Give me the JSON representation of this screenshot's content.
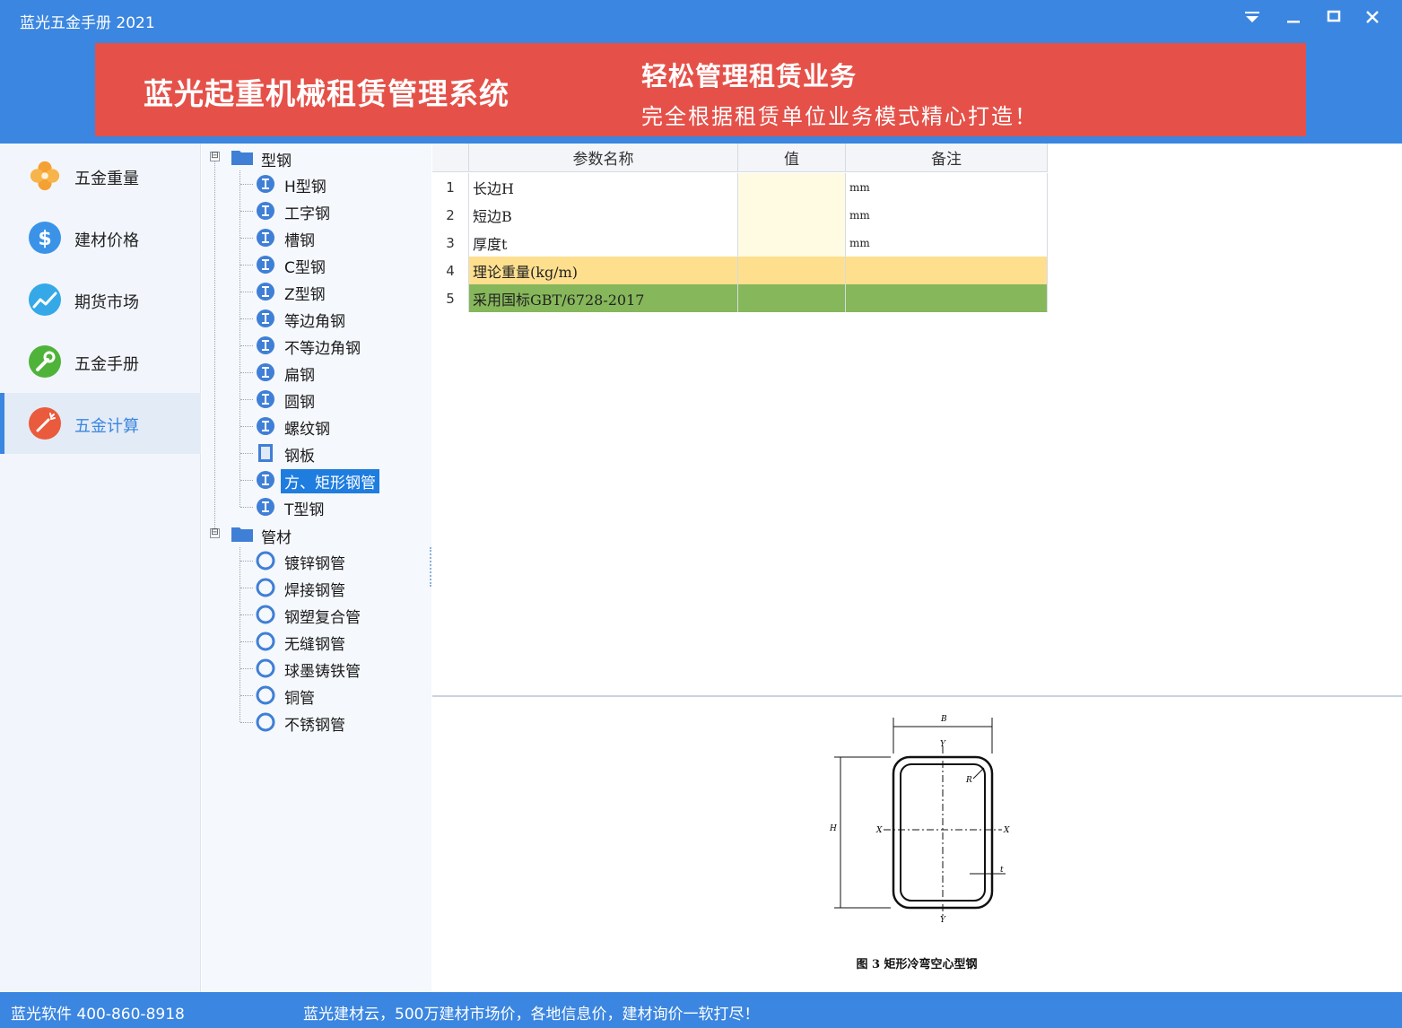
{
  "app": {
    "title": "蓝光五金手册 2021"
  },
  "window_controls": [
    "menu-icon",
    "minimize-icon",
    "maximize-icon",
    "close-icon"
  ],
  "banner": {
    "title": "蓝光起重机械租赁管理系统",
    "slogan": "轻松管理租赁业务",
    "subtitle": "完全根据租赁单位业务模式精心打造！"
  },
  "sidebar": {
    "items": [
      {
        "label": "五金重量",
        "icon": "clover-icon",
        "color": "#f5a032"
      },
      {
        "label": "建材价格",
        "icon": "dollar-icon",
        "color": "#3b93e8"
      },
      {
        "label": "期货市场",
        "icon": "trend-icon",
        "color": "#35a8e8"
      },
      {
        "label": "五金手册",
        "icon": "wrench-icon",
        "color": "#4fb33a"
      },
      {
        "label": "五金计算",
        "icon": "wand-icon",
        "color": "#ea5a3c"
      }
    ],
    "active_index": 4
  },
  "tree": {
    "groups": [
      {
        "label": "型钢",
        "expander": "⊟",
        "children": [
          {
            "label": "H型钢",
            "icon": "i-beam-icon"
          },
          {
            "label": "工字钢",
            "icon": "i-beam-icon"
          },
          {
            "label": "槽钢",
            "icon": "i-beam-icon"
          },
          {
            "label": "C型钢",
            "icon": "i-beam-icon"
          },
          {
            "label": "Z型钢",
            "icon": "i-beam-icon"
          },
          {
            "label": "等边角钢",
            "icon": "i-beam-icon"
          },
          {
            "label": "不等边角钢",
            "icon": "i-beam-icon"
          },
          {
            "label": "扁钢",
            "icon": "i-beam-icon"
          },
          {
            "label": "圆钢",
            "icon": "i-beam-icon"
          },
          {
            "label": "螺纹钢",
            "icon": "i-beam-icon"
          },
          {
            "label": "钢板",
            "icon": "plate-icon"
          },
          {
            "label": "方、矩形钢管",
            "icon": "i-beam-icon",
            "selected": true
          },
          {
            "label": "T型钢",
            "icon": "i-beam-icon"
          }
        ]
      },
      {
        "label": "管材",
        "expander": "⊟",
        "children": [
          {
            "label": "镀锌钢管",
            "icon": "ring-icon"
          },
          {
            "label": "焊接钢管",
            "icon": "ring-icon"
          },
          {
            "label": "钢塑复合管",
            "icon": "ring-icon"
          },
          {
            "label": "无缝钢管",
            "icon": "ring-icon"
          },
          {
            "label": "球墨铸铁管",
            "icon": "ring-icon"
          },
          {
            "label": "铜管",
            "icon": "ring-icon"
          },
          {
            "label": "不锈钢管",
            "icon": "ring-icon"
          }
        ]
      }
    ]
  },
  "grid": {
    "columns": [
      "参数名称",
      "值",
      "备注"
    ],
    "rows": [
      {
        "num": "1",
        "name": "长边H",
        "value": "",
        "note": "mm",
        "style": "input"
      },
      {
        "num": "2",
        "name": "短边B",
        "value": "",
        "note": "mm",
        "style": "input"
      },
      {
        "num": "3",
        "name": "厚度t",
        "value": "",
        "note": "mm",
        "style": "input"
      },
      {
        "num": "4",
        "name": "理论重量(kg/m)",
        "value": "",
        "note": "",
        "style": "result"
      },
      {
        "num": "5",
        "name": "采用国标GBT/6728-2017",
        "value": "",
        "note": "",
        "style": "standard"
      }
    ],
    "colors": {
      "input_value": "#fffbe3",
      "result": "#fddf8e",
      "standard": "#86b75a"
    }
  },
  "figure": {
    "labels": {
      "b": "B",
      "y_top": "Y",
      "y_bottom": "Y",
      "x_left": "X",
      "x_right": "X",
      "r": "R",
      "h": "H",
      "t": "t"
    },
    "caption": "图 3   矩形冷弯空心型钢"
  },
  "statusbar": {
    "left": "蓝光软件 400-860-8918",
    "right": "蓝光建材云，500万建材市场价，各地信息价，建材询价一软打尽！"
  }
}
